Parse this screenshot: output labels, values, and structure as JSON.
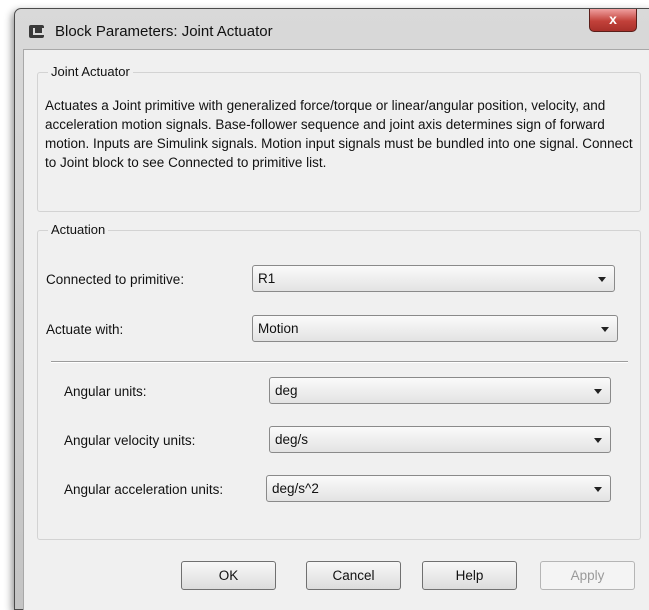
{
  "window": {
    "title": "Block Parameters: Joint Actuator",
    "close_label": "x"
  },
  "description": {
    "group_label": "Joint Actuator",
    "text": "Actuates a Joint primitive with generalized force/torque or linear/angular position, velocity, and acceleration motion signals. Base-follower sequence and joint axis determines sign of forward motion. Inputs are Simulink signals. Motion input signals must be bundled into one signal. Connect to Joint block to see Connected to primitive list."
  },
  "actuation": {
    "group_label": "Actuation",
    "connected": {
      "label": "Connected to primitive:",
      "value": "R1"
    },
    "actuate_with": {
      "label": "Actuate with:",
      "value": "Motion"
    },
    "angular_units": {
      "label": "Angular units:",
      "value": "deg"
    },
    "angular_velocity_units": {
      "label": "Angular velocity units:",
      "value": "deg/s"
    },
    "angular_acceleration_units": {
      "label": "Angular acceleration units:",
      "value": "deg/s^2"
    }
  },
  "buttons": {
    "ok": "OK",
    "cancel": "Cancel",
    "help": "Help",
    "apply": "Apply"
  }
}
